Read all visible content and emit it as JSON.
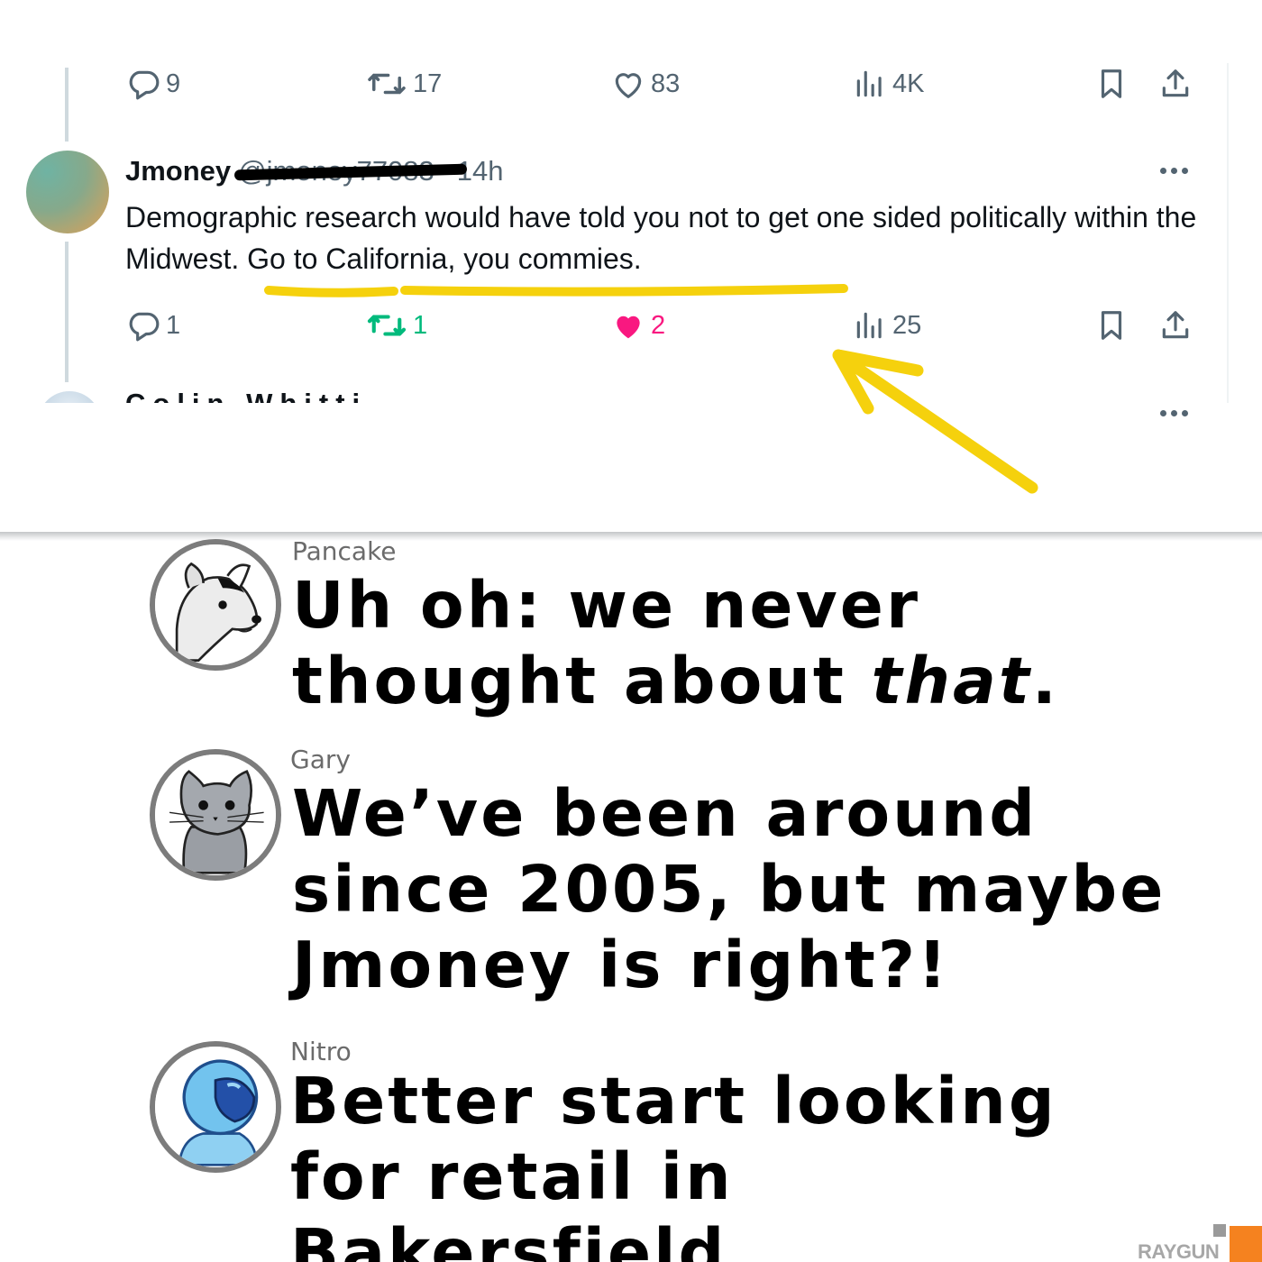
{
  "first_tweet": {
    "stats": {
      "replies": "9",
      "retweets": "17",
      "likes": "83",
      "views": "4K"
    }
  },
  "reply_tweet": {
    "display_name": "Jmoney",
    "handle": "@jmoney77083",
    "timestamp": "· 14h",
    "text": "Demographic research would have told you not to get one sided politically within the Midwest. Go to California, you commies.",
    "stats": {
      "replies": "1",
      "retweets": "1",
      "likes": "2",
      "views": "25"
    }
  },
  "next_tweet": {
    "name_fragment": "Colin Whitti"
  },
  "commentary": [
    {
      "speaker": "Pancake",
      "line_before_em": "Uh oh: we never thought about ",
      "line_em": "that",
      "line_after_em": "."
    },
    {
      "speaker": "Gary",
      "line": "We’ve been around since 2005, but maybe Jmoney is right?!"
    },
    {
      "speaker": "Nitro",
      "line": "Better start looking for retail in Bakersfield."
    }
  ],
  "watermark": "RAYGUN",
  "colors": {
    "retweeted": "#00ba7c",
    "liked": "#f91880",
    "icon_grey": "#536471",
    "annotation_yellow": "#f5d10d",
    "brand_orange": "#f5821f"
  },
  "icons": [
    "reply-icon",
    "retweet-icon",
    "like-icon",
    "views-icon",
    "bookmark-icon",
    "share-icon",
    "more-icon"
  ]
}
